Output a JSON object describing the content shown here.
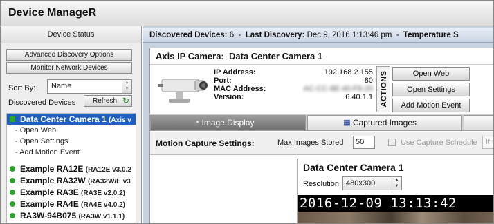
{
  "app": {
    "title": "Device ManageR"
  },
  "left": {
    "device_status": "Device Status",
    "advanced_discovery": "Advanced Discovery Options",
    "monitor_network": "Monitor Network Devices",
    "sort_by_label": "Sort By:",
    "sort_by_value": "Name",
    "discovered_devices_label": "Discovered Devices",
    "refresh_label": "Refresh",
    "devices": [
      {
        "name": "Data Center Camera 1",
        "info": "(Axis v",
        "selected": true,
        "status_color": "#2aa52a"
      },
      {
        "name": "Example RA12E",
        "info": "(RA12E v3.0.2",
        "selected": false,
        "status_color": "#2aa52a"
      },
      {
        "name": "Example RA32W",
        "info": "(RA32W/E v3",
        "selected": false,
        "status_color": "#2aa52a"
      },
      {
        "name": "Example RA3E",
        "info": "(RA3E v2.0.2)",
        "selected": false,
        "status_color": "#2aa52a"
      },
      {
        "name": "Example RA4E",
        "info": "(RA4E v4.0.2)",
        "selected": false,
        "status_color": "#2aa52a"
      },
      {
        "name": "RA3W-94B075",
        "info": "(RA3W v1.1.1)",
        "selected": false,
        "status_color": "#2aa52a"
      }
    ],
    "sub_actions": [
      "- Open Web",
      "- Open Settings",
      "- Add Motion Event"
    ]
  },
  "topbar": {
    "discovered_label": "Discovered Devices:",
    "discovered_count": "6",
    "separator": "-",
    "last_discovery_label": "Last Discovery:",
    "last_discovery_value": "Dec 9, 2016   1:13:46 pm",
    "temperature_label": "Temperature S"
  },
  "camera": {
    "type_label": "Axis IP Camera:",
    "name": "Data Center Camera 1",
    "ip_label": "IP Address:",
    "ip_value": "192.168.2.155",
    "port_label": "Port:",
    "port_value": "80",
    "mac_label": "MAC Address:",
    "mac_value": "AC-CC-8E-40-F8-20",
    "version_label": "Version:",
    "version_value": "6.40.1.1"
  },
  "actions": {
    "label": "ACTIONS",
    "open_web": "Open Web",
    "open_settings": "Open Settings",
    "add_motion_event": "Add Motion Event"
  },
  "tabs": [
    {
      "label": "Image Display",
      "active": true,
      "icon": "image-icon"
    },
    {
      "label": "Captured Images",
      "active": false,
      "icon": "grid-icon"
    }
  ],
  "motion": {
    "settings_label": "Motion Capture Settings:",
    "max_images_label": "Max Images Stored",
    "max_images_value": "50",
    "use_schedule_label": "Use Capture Schedule",
    "if_value": "If C"
  },
  "viewer": {
    "title": "Data Center Camera 1",
    "resolution_label": "Resolution",
    "resolution_value": "480x300",
    "timestamp": "2016-12-09  13:13:42"
  },
  "colors": {
    "selection": "#1f5fbf",
    "status_ok": "#2aa52a",
    "panel_bg": "#c7d2e0"
  }
}
